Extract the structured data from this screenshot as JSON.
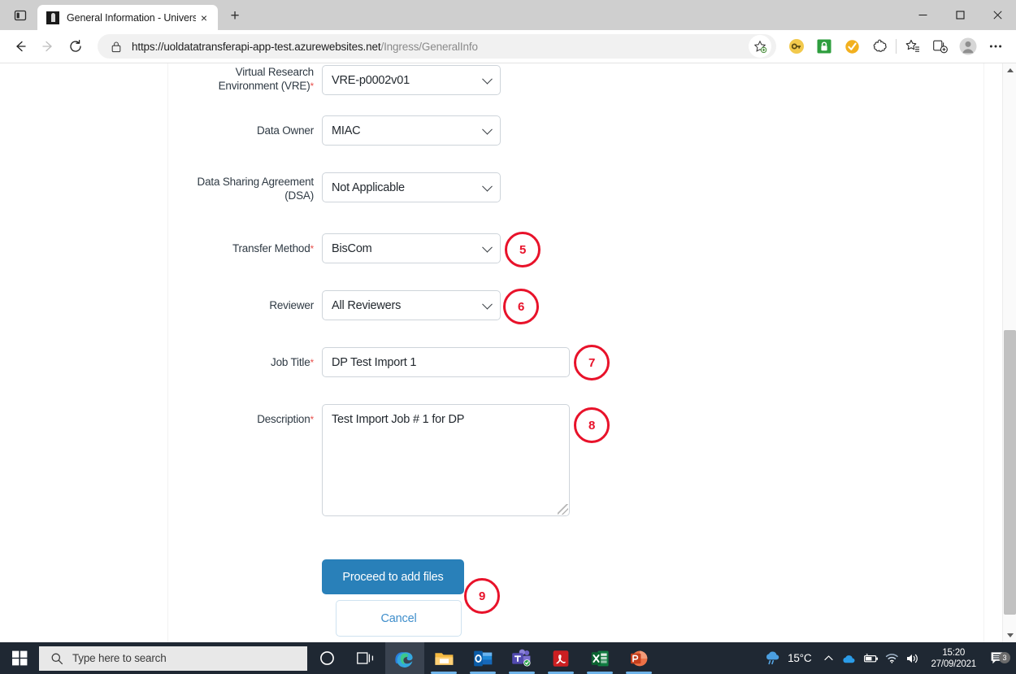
{
  "browser": {
    "tab": {
      "title": "General Information - University",
      "favicon": "document-favicon",
      "close_label": "×"
    },
    "new_tab_label": "+",
    "window_controls": {
      "minimize": "─",
      "maximize": "□",
      "close": "✕"
    },
    "nav": {
      "back": "←",
      "forward": "→",
      "reload": "↻"
    },
    "address": {
      "scheme_host": "https://uoldatatransferapi-app-test.azurewebsites.net",
      "path": "/Ingress/GeneralInfo",
      "lock_icon": "lock-icon",
      "favorite_icon": "add-favorite-icon"
    },
    "toolbar_icons": [
      "password-key-icon",
      "green-lock-icon",
      "checkmark-shield-icon",
      "collections-puzzle-icon",
      "favorites-list-icon",
      "add-tab-group-icon",
      "profile-avatar-icon",
      "settings-more-icon"
    ]
  },
  "form": {
    "fields": [
      {
        "label": "Virtual Research Environment (VRE)",
        "required": true,
        "type": "select",
        "value": "VRE-p0002v01"
      },
      {
        "label": "Data Owner",
        "required": false,
        "type": "select",
        "value": "MIAC"
      },
      {
        "label": "Data Sharing Agreement (DSA)",
        "required": false,
        "type": "select",
        "value": "Not Applicable"
      },
      {
        "label": "Transfer Method",
        "required": true,
        "type": "select",
        "value": "BisCom"
      },
      {
        "label": "Reviewer",
        "required": false,
        "type": "select",
        "value": "All Reviewers"
      },
      {
        "label": "Job Title",
        "required": true,
        "type": "text",
        "value": "DP Test Import 1"
      },
      {
        "label": "Description",
        "required": true,
        "type": "textarea",
        "value": "Test Import Job # 1 for DP"
      }
    ],
    "required_marker": "*",
    "buttons": {
      "primary": "Proceed to add files",
      "secondary": "Cancel"
    }
  },
  "annotations": [
    {
      "number": "5",
      "target": "transfer-method"
    },
    {
      "number": "6",
      "target": "reviewer"
    },
    {
      "number": "7",
      "target": "job-title"
    },
    {
      "number": "8",
      "target": "description"
    },
    {
      "number": "9",
      "target": "proceed-button"
    }
  ],
  "taskbar": {
    "start_icon": "windows-start-icon",
    "search_placeholder": "Type here to search",
    "search_icon": "search-icon",
    "apps": [
      {
        "name": "cortana-icon",
        "active": false,
        "running": false
      },
      {
        "name": "task-view-icon",
        "active": false,
        "running": false
      },
      {
        "name": "microsoft-edge-icon",
        "active": true,
        "running": true
      },
      {
        "name": "file-explorer-icon",
        "active": false,
        "running": true
      },
      {
        "name": "outlook-icon",
        "active": false,
        "running": true
      },
      {
        "name": "microsoft-teams-icon",
        "active": false,
        "running": true
      },
      {
        "name": "adobe-acrobat-icon",
        "active": false,
        "running": true
      },
      {
        "name": "excel-icon",
        "active": false,
        "running": true
      },
      {
        "name": "powerpoint-icon",
        "active": false,
        "running": true
      }
    ],
    "tray": {
      "weather_temp": "15°C",
      "weather_icon": "cloud-rain-icon",
      "show_hidden_icon": "chevron-up-icon",
      "icons": [
        "onedrive-icon",
        "battery-icon",
        "wifi-icon",
        "volume-icon"
      ],
      "time": "15:20",
      "date": "27/09/2021",
      "notification_icon": "notification-icon",
      "notification_count": "3"
    }
  },
  "colors": {
    "primary_button": "#2980b9",
    "annotation_red": "#e8122a",
    "required_red": "#e8534f",
    "taskbar": "#1f2833",
    "link_blue": "#3f8ecb"
  }
}
